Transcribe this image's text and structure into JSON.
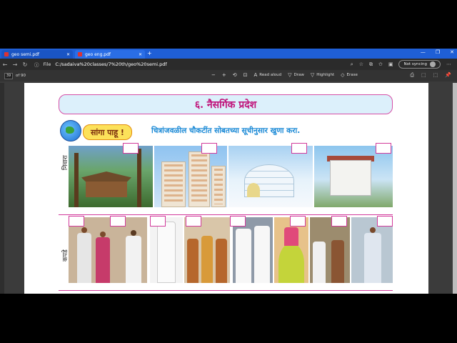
{
  "browser": {
    "tabs": [
      {
        "label": "geo semi.pdf"
      },
      {
        "label": "geo eng.pdf"
      }
    ],
    "new_tab": "+",
    "window_controls": [
      "—",
      "❐",
      "✕"
    ],
    "file_label": "File",
    "url": "C:/sadaiva%20classes/7%20th/geo%20semi.pdf",
    "sync_label": "Not syncing"
  },
  "pdf_toolbar": {
    "page_number": "39",
    "page_count": "of 90",
    "zoom_out": "−",
    "zoom_in": "+",
    "read_aloud": "Read aloud",
    "draw": "Draw",
    "highlight": "Highlight",
    "erase": "Erase"
  },
  "document": {
    "chapter_title": "६. नैसर्गिक प्रदेश",
    "sanga_label": "सांगा पाहू !",
    "instruction": "चित्रांजवळील चौकटींत सोबतच्या सूचीनुसार खुणा करा.",
    "row_shelter": "निवारा",
    "row_clothes": "कपडे"
  },
  "colors": {
    "accent": "#d23a9b",
    "title_text": "#c0137a",
    "banner_bg": "#dcf0fb",
    "instruction_text": "#1c8ad6",
    "tabbar": "#1f5fd6"
  }
}
